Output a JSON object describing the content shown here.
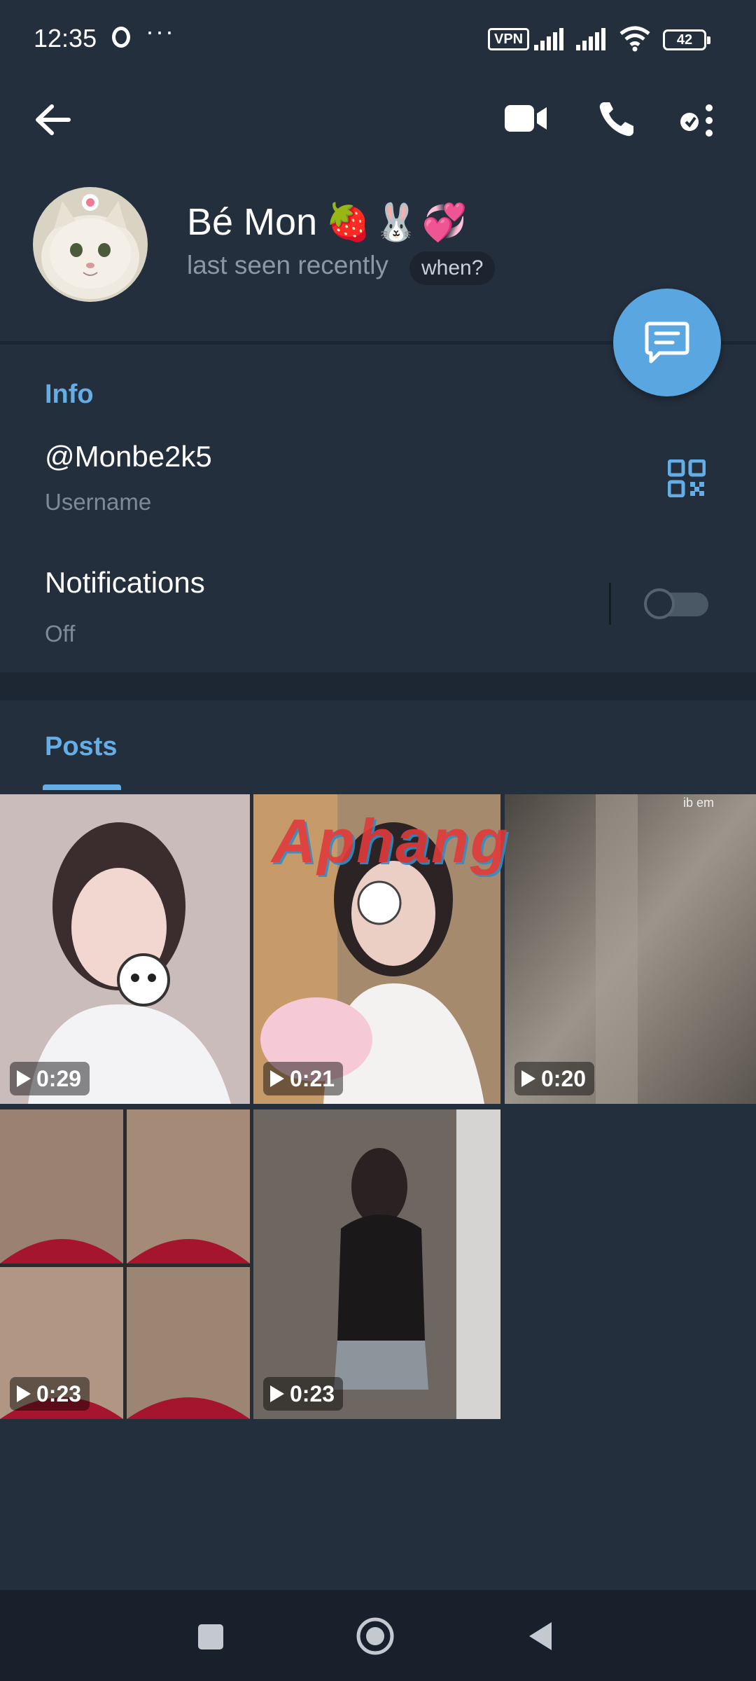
{
  "status_bar": {
    "time": "12:35",
    "more": "···",
    "vpn": "VPN",
    "battery": "42"
  },
  "toolbar": {
    "back_icon": "arrow-left",
    "video_call_icon": "video-camera",
    "call_icon": "phone",
    "more_icon": "more-vertical"
  },
  "profile": {
    "name": "Bé Mon",
    "name_emojis": "🍓🐰💞",
    "status": "last seen recently",
    "when_pill": "when?"
  },
  "info": {
    "title": "Info",
    "username": "@Monbe2k5",
    "username_label": "Username",
    "notifications_label": "Notifications",
    "notifications_value": "Off",
    "notifications_enabled": false
  },
  "posts": {
    "tab_label": "Posts",
    "watermark": "Aphang",
    "corner_text": "ib em",
    "items": [
      {
        "duration": "0:29"
      },
      {
        "duration": "0:21"
      },
      {
        "duration": "0:20"
      },
      {
        "duration": "0:23"
      },
      {
        "duration": "0:23"
      }
    ]
  },
  "colors": {
    "background": "#1d2733",
    "surface": "#242f3d",
    "accent": "#64aee8",
    "fab": "#5aa6e0"
  }
}
